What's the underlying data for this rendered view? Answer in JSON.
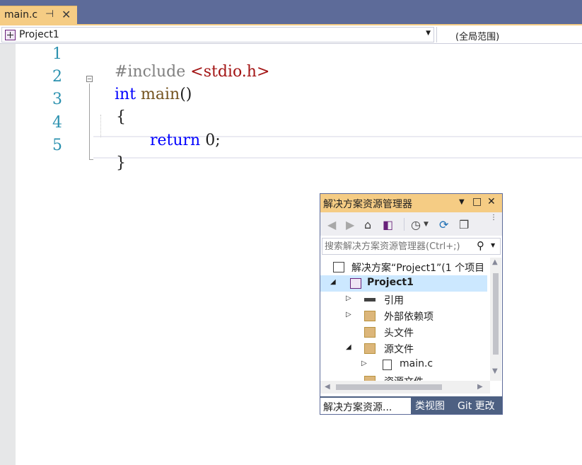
{
  "document_tab": {
    "label": "main.c",
    "pin_glyph": "⊣",
    "close_glyph": "✕"
  },
  "navbar": {
    "project": "Project1",
    "scope": "(全局范围)",
    "dropdown_glyph": "▼"
  },
  "editor": {
    "line_numbers": [
      "1",
      "2",
      "3",
      "4",
      "5"
    ],
    "line1": {
      "directive": "#include",
      "header": "<stdio.h>"
    },
    "line2": {
      "keyword": "int",
      "name": "main",
      "parens": "()"
    },
    "line3": {
      "brace": "{"
    },
    "line4": {
      "keyword": "return",
      "value": "0",
      "semicolon": ";"
    },
    "line5": {
      "brace": "}"
    }
  },
  "solution_explorer": {
    "title": "解决方案资源管理器",
    "title_buttons": {
      "dropdown": "▼",
      "maximize": "□",
      "close": "✕"
    },
    "search_placeholder": "搜索解决方案资源管理器(Ctrl+;)",
    "tree": {
      "solution": "解决方案“Project1”(1 个项目",
      "project": "Project1",
      "references": "引用",
      "external_deps": "外部依赖项",
      "header_files": "头文件",
      "source_files": "源文件",
      "main_c": "main.c",
      "resource_files": "资源文件"
    },
    "tabs": {
      "explorer": "解决方案资源...",
      "class_view": "类视图",
      "git_changes": "Git 更改"
    }
  },
  "colors": {
    "tab_active": "#f5cc84",
    "chrome": "#5d6b99",
    "keyword": "#0000ff",
    "preprocessor": "#808080",
    "string": "#a31515",
    "function": "#74531f",
    "line_number": "#2b91af",
    "selection": "#cce8ff"
  }
}
